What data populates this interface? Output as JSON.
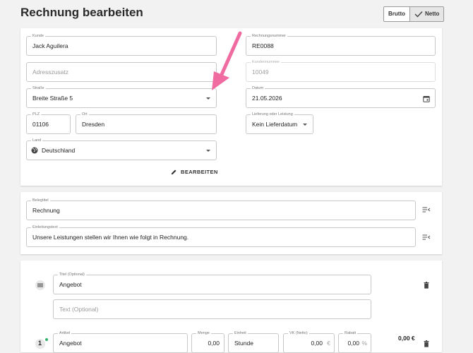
{
  "page": {
    "title": "Rechnung bearbeiten"
  },
  "price_toggle": {
    "brutto": "Brutto",
    "netto": "Netto",
    "selected": "Netto"
  },
  "customer": {
    "kunde": {
      "label": "Kunde",
      "value": "Jack Aguilera"
    },
    "adresszusatz": {
      "placeholder": "Adresszusatz"
    },
    "strasse": {
      "label": "Straße",
      "value": "Breite Straße 5"
    },
    "plz": {
      "label": "PLZ",
      "value": "01106"
    },
    "ort": {
      "label": "Ort",
      "value": "Dresden"
    },
    "land": {
      "label": "Land",
      "value": "Deutschland"
    },
    "edit_button": "BEARBEITEN"
  },
  "invoice": {
    "rechnungsnummer": {
      "label": "Rechnungsnummer",
      "value": "RE0088"
    },
    "kundennummer": {
      "label": "Kundennummer",
      "value": "10049"
    },
    "datum": {
      "label": "Datum",
      "value": "21.05.2026"
    },
    "lieferung": {
      "label": "Lieferung oder Leistung",
      "value": "Kein Lieferdatum"
    }
  },
  "document": {
    "belegtitel": {
      "label": "Belegtitel",
      "value": "Rechnung"
    },
    "einleitung": {
      "label": "Einleitungstext",
      "value": "Unsere Leistungen stellen wir Ihnen wie folgt in Rechnung."
    }
  },
  "positions": {
    "titel": {
      "label": "Titel (Optional)",
      "value": "Angebot"
    },
    "text": {
      "placeholder": "Text (Optional)"
    },
    "row": {
      "number": "1",
      "artikel": {
        "label": "Artikel",
        "value": "Angebot"
      },
      "menge": {
        "label": "Menge",
        "value": "0,00"
      },
      "einheit": {
        "label": "Einheit",
        "value": "Stunde"
      },
      "vk": {
        "label": "VK (Netto)",
        "value": "0,00",
        "unit": "€"
      },
      "rabatt": {
        "label": "Rabatt",
        "value": "0,00",
        "unit": "%"
      },
      "total": "0,00 €"
    }
  },
  "colors": {
    "accent_arrow": "#f06ba0",
    "dot": "#2fb36b"
  }
}
